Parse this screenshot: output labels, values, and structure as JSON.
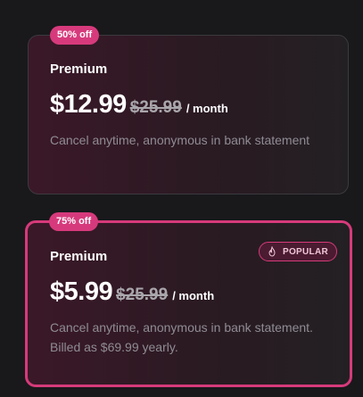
{
  "plans": [
    {
      "badge": "50% off",
      "name": "Premium",
      "price": "$12.99",
      "old_price": "$25.99",
      "period": "/ month",
      "description": "Cancel anytime, anonymous in bank statement",
      "selected": false
    },
    {
      "badge": "75% off",
      "name": "Premium",
      "price": "$5.99",
      "old_price": "$25.99",
      "period": "/ month",
      "description": "Cancel anytime, anonymous in bank statement. Billed as $69.99 yearly.",
      "selected": true,
      "tag_label": "POPULAR",
      "tag_icon": "flame-icon"
    }
  ],
  "colors": {
    "accent": "#d73a7c",
    "background": "#19181b",
    "muted_text": "#8f8c94"
  }
}
